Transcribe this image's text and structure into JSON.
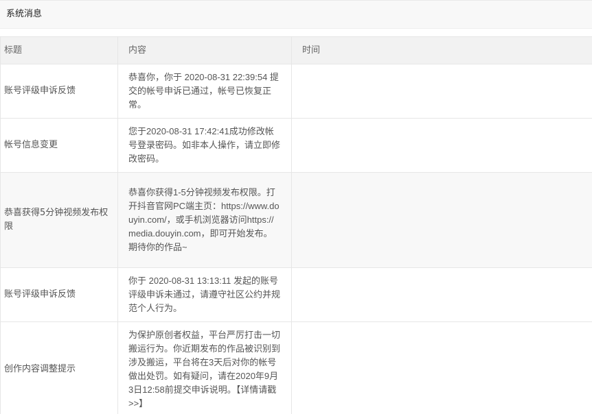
{
  "panel": {
    "title": "系统消息"
  },
  "table": {
    "headers": {
      "title": "标题",
      "content": "内容",
      "time": "时间"
    },
    "rows": [
      {
        "title": "账号评级申诉反馈",
        "content": "恭喜你，你于 2020-08-31 22:39:54 提交的帐号申诉已通过，帐号已恢复正常。",
        "time": ""
      },
      {
        "title": "帐号信息变更",
        "content": "您于2020-08-31 17:42:41成功修改帐号登录密码。如非本人操作，请立即修改密码。",
        "time": ""
      },
      {
        "title": "恭喜获得5分钟视频发布权限",
        "content": "恭喜你获得1-5分钟视频发布权限。打开抖音官网PC端主页：https://www.douyin.com/，或手机浏览器访问https://media.douyin.com，即可开始发布。期待你的作品~",
        "time": ""
      },
      {
        "title": "账号评级申诉反馈",
        "content": "你于 2020-08-31 13:13:11 发起的账号评级申诉未通过，请遵守社区公约并规范个人行为。",
        "time": ""
      },
      {
        "title": "创作内容调整提示",
        "content": "为保护原创者权益，平台严厉打击一切搬运行为。你近期发布的作品被识别到涉及搬运，平台将在3天后对你的帐号做出处罚。如有疑问，请在2020年9月3日12:58前提交申诉说明。【详情请戳>>】",
        "time": ""
      }
    ]
  }
}
